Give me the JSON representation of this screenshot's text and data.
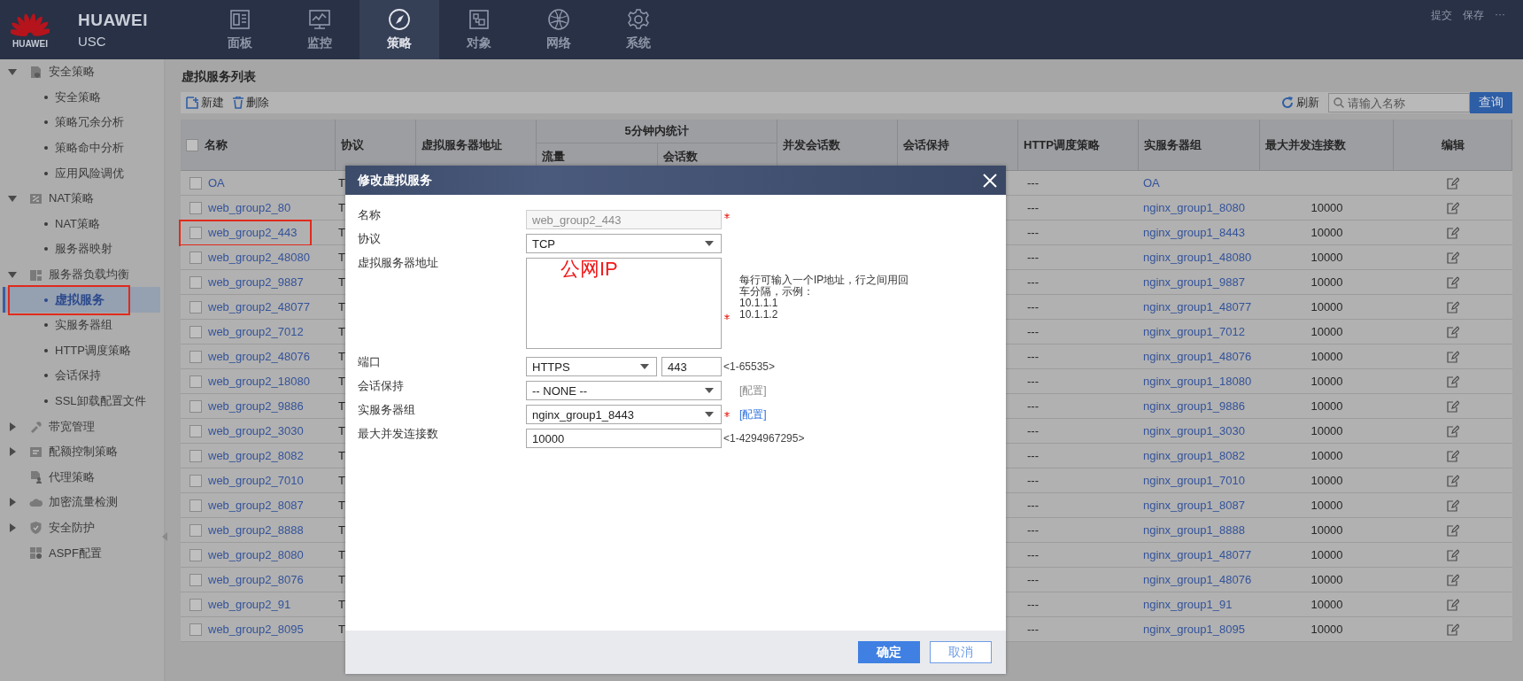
{
  "header": {
    "logo_text": "HUAWEI",
    "brand": "HUAWEI",
    "device": "USC",
    "nav": [
      {
        "label": "面板",
        "selected": false
      },
      {
        "label": "监控",
        "selected": false
      },
      {
        "label": "策略",
        "selected": true
      },
      {
        "label": "对象",
        "selected": false
      },
      {
        "label": "网络",
        "selected": false
      },
      {
        "label": "系统",
        "selected": false
      }
    ],
    "actions": [
      "提交",
      "保存",
      "···"
    ]
  },
  "sidebar": {
    "items": [
      {
        "label": "安全策略",
        "kind": "group",
        "expanded": true,
        "children": [
          {
            "label": "安全策略",
            "selected": false,
            "highlighted": false
          },
          {
            "label": "策略冗余分析",
            "selected": false,
            "highlighted": false
          },
          {
            "label": "策略命中分析",
            "selected": false,
            "highlighted": false
          },
          {
            "label": "应用风险调优",
            "selected": false,
            "highlighted": false
          }
        ]
      },
      {
        "label": "NAT策略",
        "kind": "group",
        "expanded": true,
        "children": [
          {
            "label": "NAT策略",
            "selected": false,
            "highlighted": false
          },
          {
            "label": "服务器映射",
            "selected": false,
            "highlighted": false
          }
        ]
      },
      {
        "label": "服务器负载均衡",
        "kind": "group",
        "expanded": true,
        "children": [
          {
            "label": "虚拟服务",
            "selected": true,
            "highlighted": true
          },
          {
            "label": "实服务器组",
            "selected": false,
            "highlighted": false
          },
          {
            "label": "HTTP调度策略",
            "selected": false,
            "highlighted": false
          },
          {
            "label": "会话保持",
            "selected": false,
            "highlighted": false
          },
          {
            "label": "SSL卸载配置文件",
            "selected": false,
            "highlighted": false
          }
        ]
      },
      {
        "label": "带宽管理",
        "kind": "group",
        "expanded": false
      },
      {
        "label": "配额控制策略",
        "kind": "group",
        "expanded": false
      },
      {
        "label": "代理策略",
        "kind": "link"
      },
      {
        "label": "加密流量检测",
        "kind": "group",
        "expanded": false
      },
      {
        "label": "安全防护",
        "kind": "group",
        "expanded": false
      },
      {
        "label": "ASPF配置",
        "kind": "link"
      }
    ]
  },
  "page": {
    "title": "虚拟服务列表",
    "toolbar": {
      "new": "新建",
      "delete": "删除",
      "refresh": "刷新",
      "search_placeholder": "请输入名称",
      "search_button": "查询"
    }
  },
  "table": {
    "header_checked": false,
    "columns": [
      {
        "label": "名称"
      },
      {
        "label": "协议"
      },
      {
        "label": "虚拟服务器地址"
      },
      {
        "label": "5分钟内统计",
        "children": [
          {
            "label": "流量"
          },
          {
            "label": "会话数"
          }
        ]
      },
      {
        "label": "并发会话数"
      },
      {
        "label": "会话保持"
      },
      {
        "label": "HTTP调度策略"
      },
      {
        "label": "实服务器组"
      },
      {
        "label": "最大并发连接数"
      },
      {
        "label": "编辑"
      }
    ],
    "rows": [
      {
        "name": "OA",
        "checked": false,
        "highlighted": false,
        "protocol": "T",
        "http_policy": "---",
        "server_group": "OA"
      },
      {
        "name": "web_group2_80",
        "checked": false,
        "highlighted": false,
        "protocol": "T",
        "http_policy": "---",
        "server_group": "nginx_group1_8080",
        "max_connections": "10000"
      },
      {
        "name": "web_group2_443",
        "checked": false,
        "highlighted": true,
        "protocol": "T",
        "http_policy": "---",
        "server_group": "nginx_group1_8443",
        "max_connections": "10000"
      },
      {
        "name": "web_group2_48080",
        "checked": false,
        "highlighted": false,
        "protocol": "T",
        "http_policy": "---",
        "server_group": "nginx_group1_48080",
        "max_connections": "10000"
      },
      {
        "name": "web_group2_9887",
        "checked": false,
        "highlighted": false,
        "protocol": "T",
        "http_policy": "---",
        "server_group": "nginx_group1_9887",
        "max_connections": "10000"
      },
      {
        "name": "web_group2_48077",
        "checked": false,
        "highlighted": false,
        "protocol": "T",
        "http_policy": "---",
        "server_group": "nginx_group1_48077",
        "max_connections": "10000"
      },
      {
        "name": "web_group2_7012",
        "checked": false,
        "highlighted": false,
        "protocol": "T",
        "http_policy": "---",
        "server_group": "nginx_group1_7012",
        "max_connections": "10000"
      },
      {
        "name": "web_group2_48076",
        "checked": false,
        "highlighted": false,
        "protocol": "T",
        "http_policy": "---",
        "server_group": "nginx_group1_48076",
        "max_connections": "10000"
      },
      {
        "name": "web_group2_18080",
        "checked": false,
        "highlighted": false,
        "protocol": "T",
        "http_policy": "---",
        "server_group": "nginx_group1_18080",
        "max_connections": "10000"
      },
      {
        "name": "web_group2_9886",
        "checked": false,
        "highlighted": false,
        "protocol": "T",
        "http_policy": "---",
        "server_group": "nginx_group1_9886",
        "max_connections": "10000"
      },
      {
        "name": "web_group2_3030",
        "checked": false,
        "highlighted": false,
        "protocol": "T",
        "http_policy": "---",
        "server_group": "nginx_group1_3030",
        "max_connections": "10000"
      },
      {
        "name": "web_group2_8082",
        "checked": false,
        "highlighted": false,
        "protocol": "T",
        "http_policy": "---",
        "server_group": "nginx_group1_8082",
        "max_connections": "10000"
      },
      {
        "name": "web_group2_7010",
        "checked": false,
        "highlighted": false,
        "protocol": "T",
        "http_policy": "---",
        "server_group": "nginx_group1_7010",
        "max_connections": "10000"
      },
      {
        "name": "web_group2_8087",
        "checked": false,
        "highlighted": false,
        "protocol": "T",
        "http_policy": "---",
        "server_group": "nginx_group1_8087",
        "max_connections": "10000"
      },
      {
        "name": "web_group2_8888",
        "checked": false,
        "highlighted": false,
        "protocol": "T",
        "http_policy": "---",
        "server_group": "nginx_group1_8888",
        "max_connections": "10000"
      },
      {
        "name": "web_group2_8080",
        "checked": false,
        "highlighted": false,
        "protocol": "T",
        "http_policy": "---",
        "server_group": "nginx_group1_48077",
        "max_connections": "10000"
      },
      {
        "name": "web_group2_8076",
        "checked": false,
        "highlighted": false,
        "protocol": "T",
        "http_policy": "---",
        "server_group": "nginx_group1_48076",
        "max_connections": "10000"
      },
      {
        "name": "web_group2_91",
        "checked": false,
        "highlighted": false,
        "protocol": "T",
        "http_policy": "---",
        "server_group": "nginx_group1_91",
        "max_connections": "10000"
      },
      {
        "name": "web_group2_8095",
        "checked": false,
        "highlighted": false,
        "protocol": "T",
        "http_policy": "---",
        "server_group": "nginx_group1_8095",
        "max_connections": "10000"
      }
    ]
  },
  "dialog": {
    "title": "修改虚拟服务",
    "fields": [
      {
        "kind": "text",
        "label": "名称",
        "value": "web_group2_443",
        "disabled": true,
        "required": true
      },
      {
        "kind": "select",
        "label": "协议",
        "value": "TCP",
        "disabled": false,
        "required": false
      },
      {
        "kind": "textarea",
        "label": "虚拟服务器地址",
        "value": "公网IP",
        "disabled": false,
        "required": true,
        "hint": [
          "每行可输入一个IP地址，行之间用回车分隔，示例：",
          "10.1.1.1",
          "10.1.1.2"
        ]
      },
      {
        "kind": "port",
        "label": "端口",
        "value": "HTTPS",
        "port": "443",
        "range": "<1-65535>",
        "disabled": false,
        "required": false
      },
      {
        "kind": "select",
        "label": "会话保持",
        "value": "-- NONE --",
        "disabled": false,
        "required": false,
        "link": "[配置]",
        "link_disabled": true
      },
      {
        "kind": "select",
        "label": "实服务器组",
        "value": "nginx_group1_8443",
        "disabled": false,
        "required": true,
        "link": "[配置]",
        "link_disabled": false
      },
      {
        "kind": "text",
        "label": "最大并发连接数",
        "value": "10000",
        "range": "<1-4294967295>",
        "disabled": false,
        "required": false
      }
    ],
    "buttons": [
      {
        "label": "确定",
        "kind": "primary"
      },
      {
        "label": "取消",
        "kind": "secondary"
      }
    ]
  }
}
